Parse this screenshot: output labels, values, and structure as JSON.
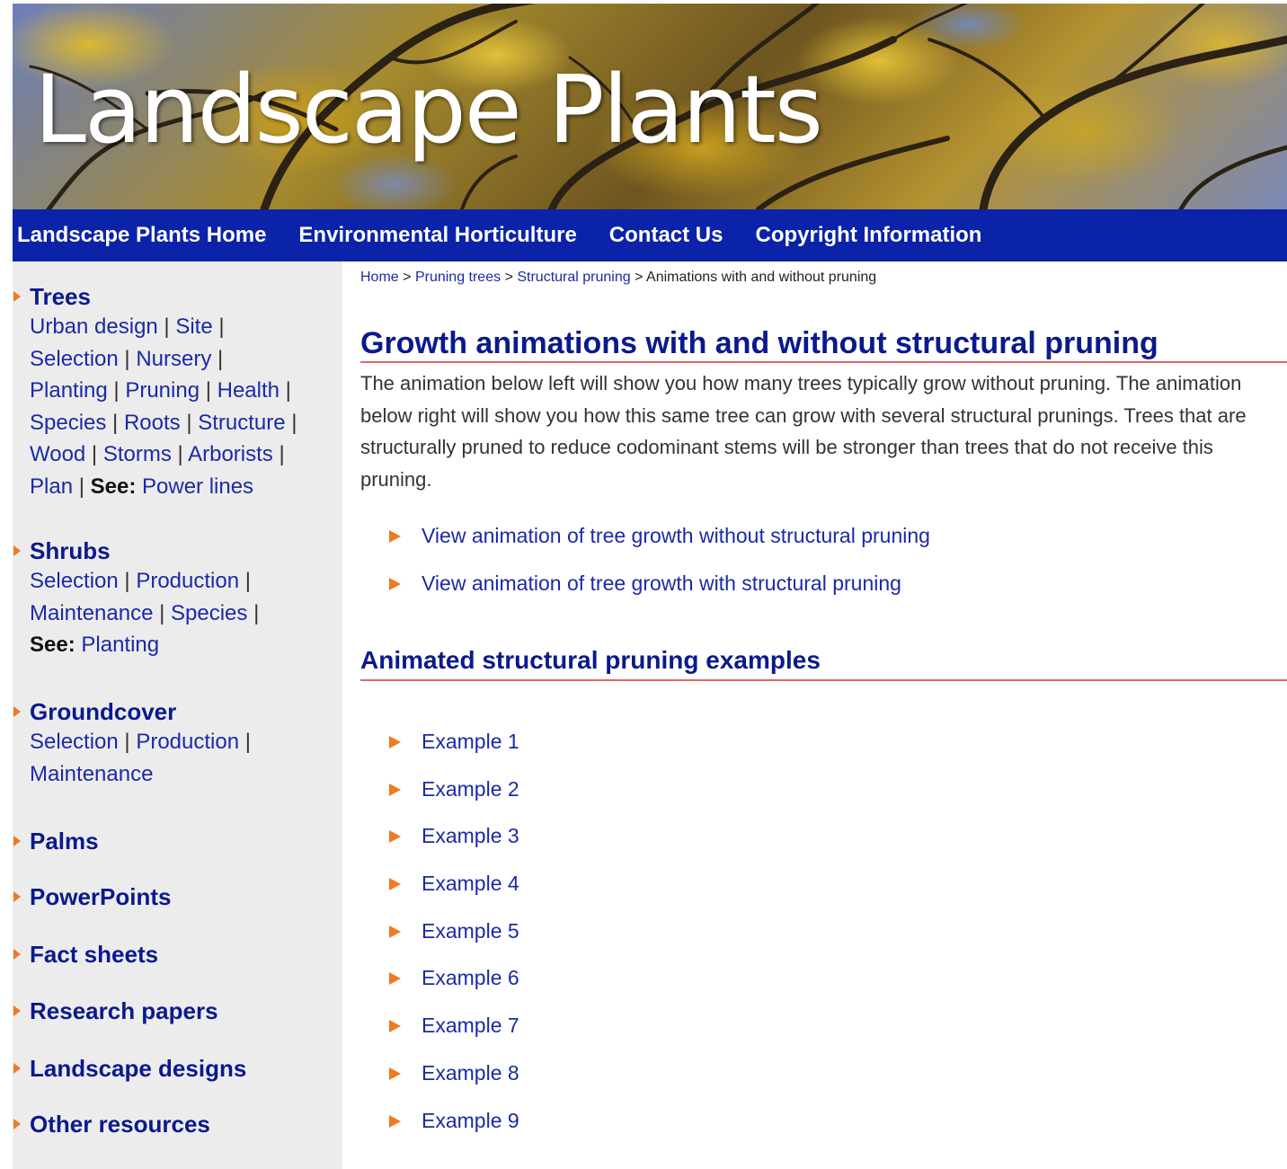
{
  "banner": {
    "title": "Landscape Plants"
  },
  "topnav": [
    {
      "label": "Landscape Plants Home"
    },
    {
      "label": "Environmental Horticulture"
    },
    {
      "label": "Contact Us"
    },
    {
      "label": "Copyright Information"
    }
  ],
  "sidebar": {
    "see_label": "See:",
    "trees": {
      "title": "Trees",
      "links": [
        "Urban design",
        "Site",
        "Selection",
        "Nursery",
        "Planting",
        "Pruning",
        "Health",
        "Species",
        "Roots",
        "Structure",
        "Wood",
        "Storms",
        "Arborists",
        "Plan"
      ],
      "see_link": "Power lines"
    },
    "shrubs": {
      "title": "Shrubs",
      "links": [
        "Selection",
        "Production",
        "Maintenance",
        "Species"
      ],
      "see_link": "Planting"
    },
    "groundcover": {
      "title": "Groundcover",
      "links": [
        "Selection",
        "Production",
        "Maintenance"
      ]
    },
    "palms": {
      "title": "Palms"
    },
    "powerpoints": {
      "title": "PowerPoints"
    },
    "fact_sheets": {
      "title": "Fact sheets"
    },
    "research_papers": {
      "title": "Research papers"
    },
    "landscape_designs": {
      "title": "Landscape designs"
    },
    "other_resources": {
      "title": "Other resources"
    }
  },
  "breadcrumb": {
    "items": [
      "Home",
      "Pruning trees",
      "Structural pruning"
    ],
    "current": "Animations with and without pruning",
    "separator": ">"
  },
  "main": {
    "title": "Growth animations with and without structural pruning",
    "intro": "The animation below left will show you how many trees typically grow without pruning. The animation below right will show you how this same tree can grow with several structural prunings. Trees that are structurally pruned to reduce codominant stems will be stronger than trees that do not receive this pruning.",
    "animation_links": [
      "View animation of tree growth without structural pruning",
      "View animation of tree growth with structural pruning"
    ],
    "examples_title": "Animated structural pruning examples",
    "examples": [
      "Example 1",
      "Example 2",
      "Example 3",
      "Example 4",
      "Example 5",
      "Example 6",
      "Example 7",
      "Example 8",
      "Example 9"
    ]
  },
  "colors": {
    "nav_background": "#0a23a8",
    "heading_blue": "#0a1a8c",
    "link_blue": "#1a2aa8",
    "bullet_orange": "#ef7a22",
    "rule_red": "#e06666",
    "sidebar_background": "#ececec"
  }
}
